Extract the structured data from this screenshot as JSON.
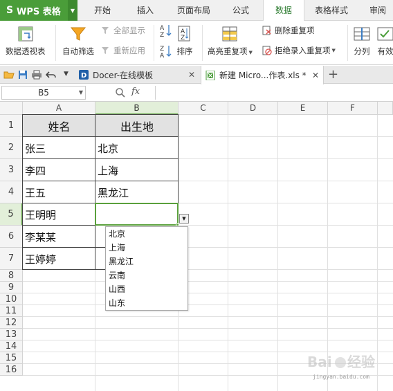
{
  "app": {
    "name": "WPS 表格",
    "logo_mark": "S"
  },
  "menu": {
    "tabs": [
      {
        "label": "开始"
      },
      {
        "label": "插入"
      },
      {
        "label": "页面布局"
      },
      {
        "label": "公式"
      },
      {
        "label": "数据",
        "active": true
      },
      {
        "label": "表格样式"
      },
      {
        "label": "审阅"
      }
    ]
  },
  "ribbon": {
    "pivot": "数据透视表",
    "autofilter": "自动筛选",
    "show_all": "全部显示",
    "reapply": "重新应用",
    "sort": "排序",
    "highlight_dup": "高亮重复项",
    "remove_dup": "删除重复项",
    "reject_dup": "拒绝录入重复项",
    "split": "分列",
    "validity": "有效"
  },
  "doctabs": {
    "tabs": [
      {
        "label": "Docer-在线模板",
        "icon": "docer-icon"
      },
      {
        "label": "新建 Micro...作表.xls *",
        "icon": "xls-icon",
        "active": true
      }
    ],
    "add": "+"
  },
  "formula_bar": {
    "cell_ref": "B5",
    "fx": "fx",
    "value": ""
  },
  "sheet": {
    "columns": [
      "A",
      "B",
      "C",
      "D",
      "E",
      "F"
    ],
    "rows": [
      "1",
      "2",
      "3",
      "4",
      "5",
      "6",
      "7",
      "8",
      "9",
      "10",
      "11",
      "12",
      "13",
      "14",
      "15",
      "16"
    ],
    "selected_cell": "B5",
    "table": [
      [
        "姓名",
        "出生地"
      ],
      [
        "张三",
        "北京"
      ],
      [
        "李四",
        "上海"
      ],
      [
        "王五",
        "黑龙江"
      ],
      [
        "王明明",
        ""
      ],
      [
        "李某某",
        ""
      ],
      [
        "王婷婷",
        ""
      ]
    ],
    "dropdown_options": [
      "北京",
      "上海",
      "黑龙江",
      "云南",
      "山西",
      "山东"
    ]
  },
  "colors": {
    "brand_green": "#4a9d39",
    "selection_green": "#5aa03c",
    "header_fill": "#e2e2e2"
  }
}
